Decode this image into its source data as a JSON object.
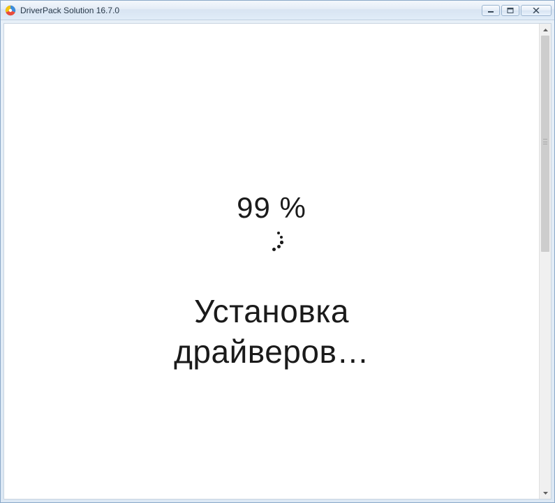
{
  "window": {
    "title": "DriverPack Solution 16.7.0"
  },
  "progress": {
    "percent_text": "99 %"
  },
  "status": {
    "line1": "Установка",
    "line2": "драйверов…"
  },
  "icons": {
    "app": "driverpack-icon",
    "minimize": "minimize-icon",
    "maximize": "maximize-icon",
    "close": "close-icon"
  }
}
